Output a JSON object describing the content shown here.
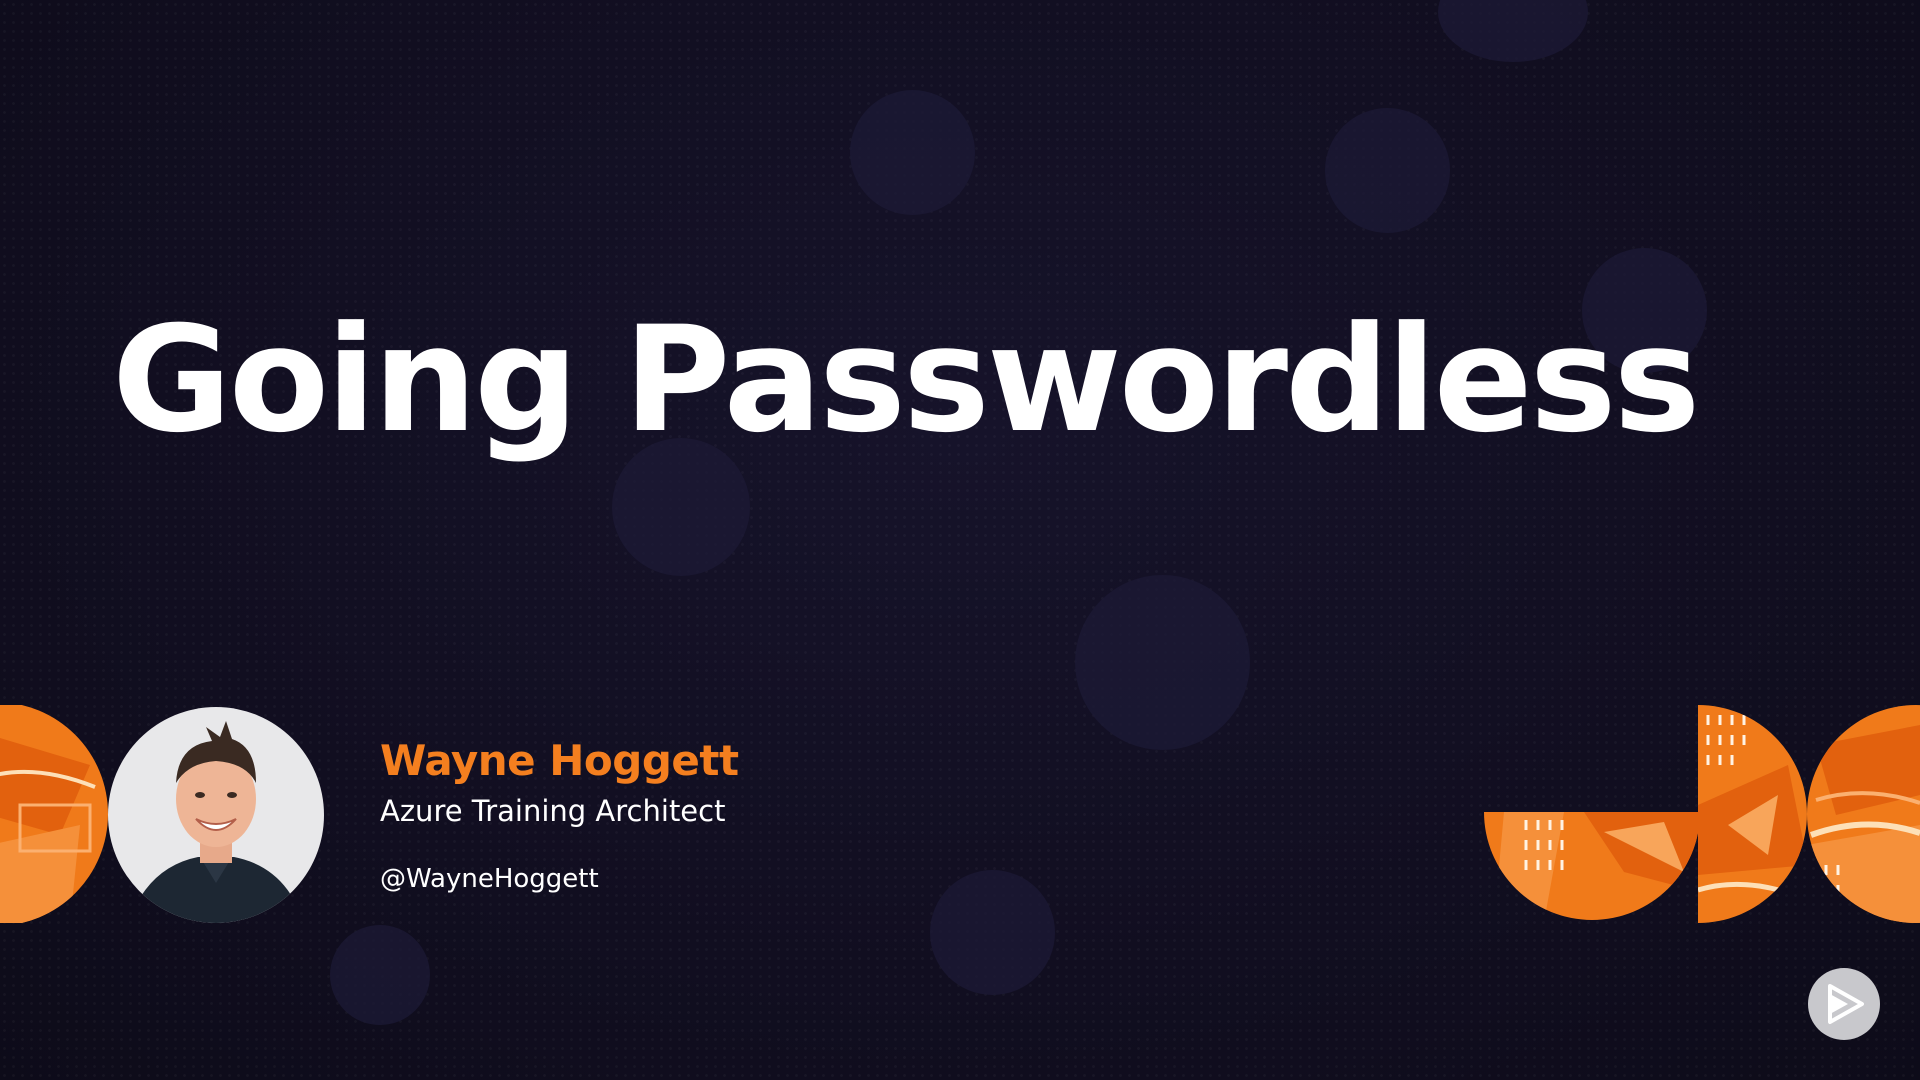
{
  "slide": {
    "title": "Going Passwordless",
    "presenter": {
      "name": "Wayne Hoggett",
      "role": "Azure Training Architect",
      "handle": "@WayneHoggett"
    }
  },
  "icons": {
    "play": "play-icon",
    "avatar": "presenter-photo"
  },
  "colors": {
    "background": "#120f22",
    "accent": "#f47f1f",
    "accent_dark": "#e0620d",
    "title": "#ffffff"
  }
}
